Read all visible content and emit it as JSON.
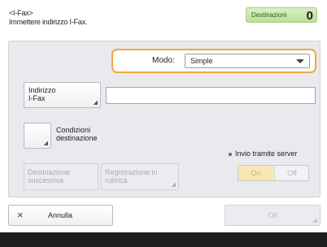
{
  "header": {
    "app_title": "<I-Fax>",
    "subtitle": "Immettere indirizzo I-Fax.",
    "destinations_label": "Destinazioni",
    "destinations_count": "0"
  },
  "mode": {
    "label": "Modo:",
    "value": "Simple"
  },
  "address": {
    "button_label_line1": "Indirizzo",
    "button_label_line2": "I-Fax",
    "input_value": ""
  },
  "conditions": {
    "label_line1": "Condizioni",
    "label_line2": "destinazione"
  },
  "server_send": {
    "label": "Invio tramite server",
    "on_label": "On",
    "off_label": "Off",
    "selected": "On"
  },
  "actions": {
    "next_destination_line1": "Destinazione",
    "next_destination_line2": "successiva",
    "register_line1": "Registrazione in",
    "register_line2": "rubrica",
    "cancel_label": "Annulla",
    "ok_label": "OK"
  },
  "icons": {
    "cancel": "close-icon",
    "mode_dropdown": "chevron-down-icon",
    "corner": "corner-arrow-icon"
  },
  "colors": {
    "focus_outline": "#f0a83a",
    "destinations_badge": "#c3e6a4",
    "toggle_on": "#f6e7b3",
    "server_bullet": "#2a72c8"
  }
}
